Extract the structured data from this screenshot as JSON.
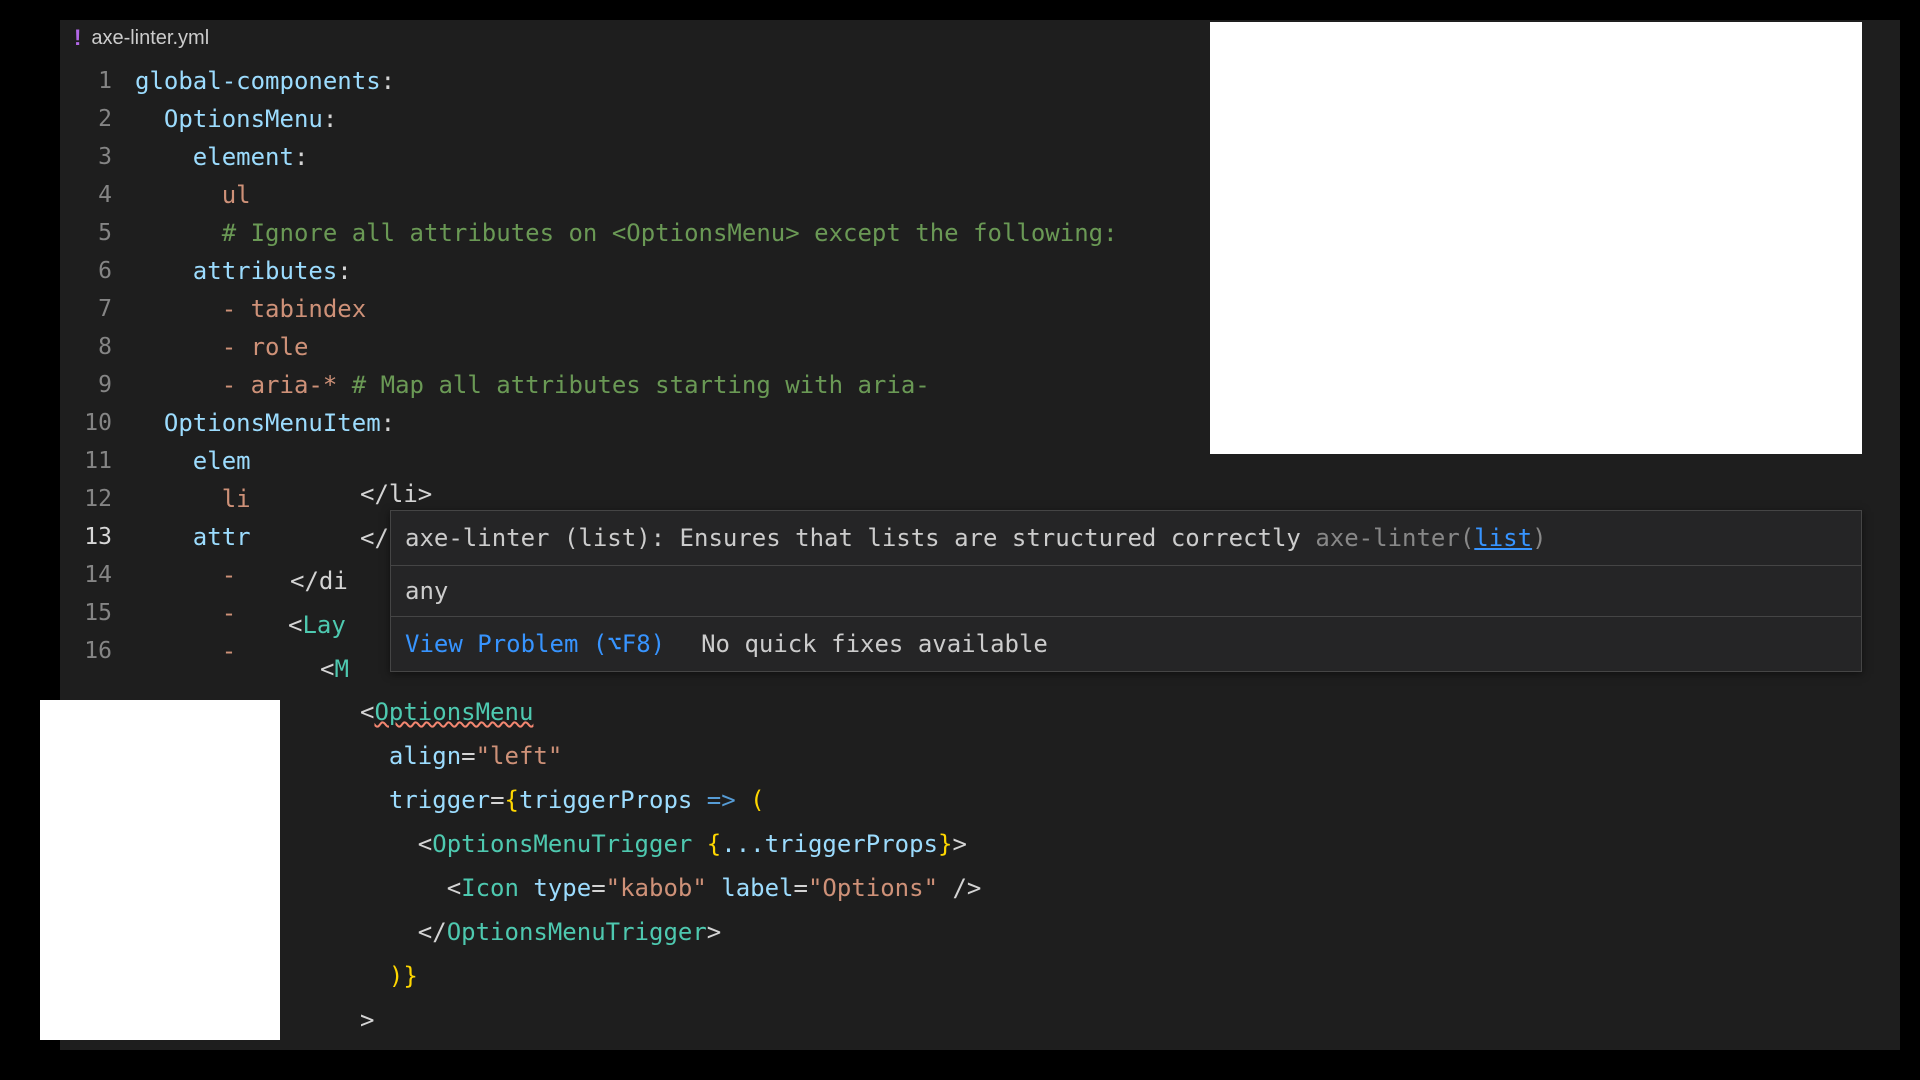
{
  "tab": {
    "icon_glyph": "!",
    "filename": "axe-linter.yml"
  },
  "gutter": {
    "lines": [
      "1",
      "2",
      "3",
      "4",
      "5",
      "6",
      "7",
      "8",
      "9",
      "10",
      "11",
      "12",
      "13",
      "14",
      "15",
      "16"
    ],
    "active_index": 12
  },
  "code": {
    "l1_key": "global-components",
    "l2_key": "OptionsMenu",
    "l3_key": "element",
    "l4_val": "ul",
    "l5_comment": "# Ignore all attributes on <OptionsMenu> except the following:",
    "l6_key": "attributes",
    "l7_val": "- tabindex",
    "l8_val": "- role",
    "l9_val_a": "- aria-*",
    "l9_comment": "# Map all attributes starting with aria-",
    "l10_key": "OptionsMenuItem",
    "l11_frag": "elem",
    "l12_frag": "li",
    "l13_frag": "attr",
    "l14_frag": "-",
    "l15_frag": "-",
    "l16_frag": "-"
  },
  "hover": {
    "prefix": "axe-linter (list):",
    "message": "Ensures that lists are structured correctly",
    "source": "axe-linter",
    "link_text": "list",
    "type_line": "any",
    "view_problem": "View Problem (⌥F8)",
    "no_fix": "No quick fixes available"
  },
  "secondary": {
    "s1": "</li>",
    "s2": "</",
    "s3": "</di",
    "s4": "<Lay",
    "s5": "<M",
    "s6_open": "<",
    "s6_tag": "OptionsMenu",
    "s7_attr": "align",
    "s7_eq": "=",
    "s7_val": "\"left\"",
    "s8_attr": "trigger",
    "s8_eq": "=",
    "s8_brace_o": "{",
    "s8_fn": "triggerProps",
    "s8_arrow": " => ",
    "s8_paren": "(",
    "s9_open": "<",
    "s9_tag": "OptionsMenuTrigger",
    "s9_spread_o": " {",
    "s9_spread": "...triggerProps",
    "s9_spread_c": "}",
    "s9_close": ">",
    "s10_open": "<",
    "s10_tag": "Icon",
    "s10_a1": " type",
    "s10_eq1": "=",
    "s10_v1": "\"kabob\"",
    "s10_a2": " label",
    "s10_eq2": "=",
    "s10_v2": "\"Options\"",
    "s10_close": " />",
    "s11_open": "</",
    "s11_tag": "OptionsMenuTrigger",
    "s11_close": ">",
    "s12_close": ")}",
    "s13_close": ">"
  }
}
